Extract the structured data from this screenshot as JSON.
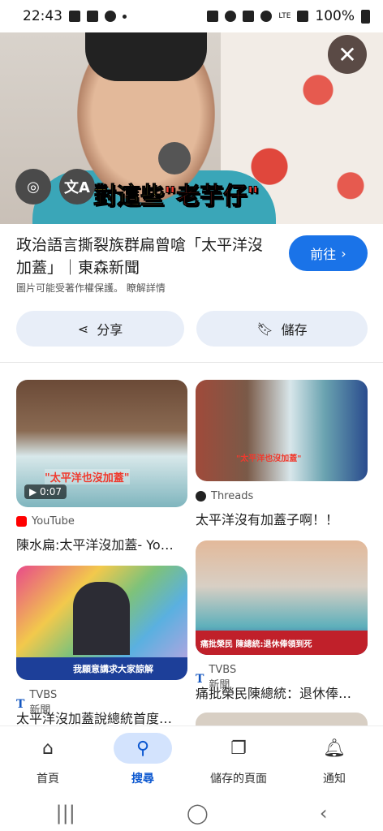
{
  "status": {
    "time": "22:43",
    "battery": "100%",
    "network": "LTE"
  },
  "hero": {
    "caption_pre": "對這些",
    "caption_quote": "\"老芋仔\""
  },
  "result": {
    "title": "政治語言撕裂族群扁曾嗆「太平洋沒加蓋」｜東森新聞",
    "go_label": "前往",
    "copyright_note": "圖片可能受著作權保護。",
    "learn_more": "瞭解詳情",
    "share_label": "分享",
    "save_label": "儲存"
  },
  "cards": [
    {
      "source": "YouTube",
      "title": "陳水扁:太平洋沒加蓋- Yo…",
      "duration": "0:07",
      "thumb_caption": "\"太平洋也沒加蓋\""
    },
    {
      "source": "Threads",
      "title": "太平洋沒有加蓋子啊！！",
      "thumb_caption": "\"太平洋也沒加蓋\""
    },
    {
      "source": "TVBS新聞",
      "title": "太平洋沒加蓋說總統首度…",
      "thumb_caption": "我願意講求大家諒解"
    },
    {
      "source": "TVBS新聞",
      "title": "痛批榮民陳總統：退休俸…",
      "thumb_caption": "痛批榮民 陳總統:退休俸領到死"
    }
  ],
  "nav": {
    "home": "首頁",
    "search": "搜尋",
    "saved": "儲存的頁面",
    "notifications": "通知"
  }
}
